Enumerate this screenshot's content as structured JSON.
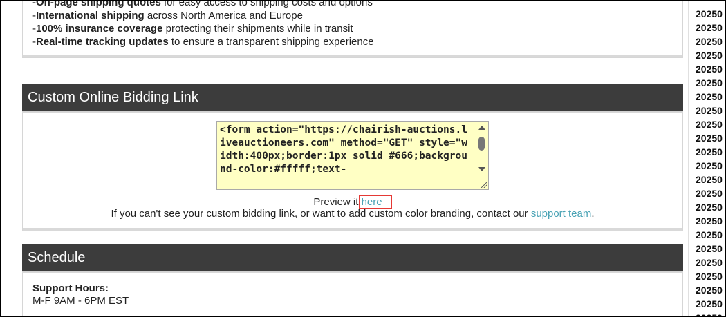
{
  "features": [
    {
      "bold": "On-page shipping quotes",
      "rest": " for easy access to shipping costs and options"
    },
    {
      "bold": "International shipping",
      "rest": " across North America and Europe"
    },
    {
      "bold": "100% insurance coverage",
      "rest": " protecting their shipments while in transit"
    },
    {
      "bold": "Real-time tracking updates",
      "rest": " to ensure a transparent shipping experience"
    }
  ],
  "bidding": {
    "title": "Custom Online Bidding Link",
    "code": "<form action=\"https://chairish-auctions.liveauctioneers.com\" method=\"GET\" style=\"width:400px;border:1px solid #666;background-color:#fffff;text-",
    "preview_prefix": "Preview it ",
    "preview_link": "here",
    "help_text": "If you can't see your custom bidding link, or want to add custom color branding, contact our ",
    "support_link": "support team",
    "help_suffix": "."
  },
  "schedule": {
    "title": "Schedule",
    "support_label": "Support Hours:",
    "hours": "M-F 9AM - 6PM EST"
  },
  "dates": [
    "20250",
    "20250",
    "20250",
    "20250",
    "20250",
    "20250",
    "20250",
    "20250",
    "20250",
    "20250",
    "20250",
    "20250",
    "20250",
    "20250",
    "20250",
    "20250",
    "20250",
    "20250",
    "20250",
    "20250",
    "20250",
    "20250",
    "20250"
  ],
  "colors": {
    "header": "#3c3c3c",
    "link": "#4aa3b5",
    "code_bg": "#ffffc4",
    "highlight": "#e53935"
  }
}
